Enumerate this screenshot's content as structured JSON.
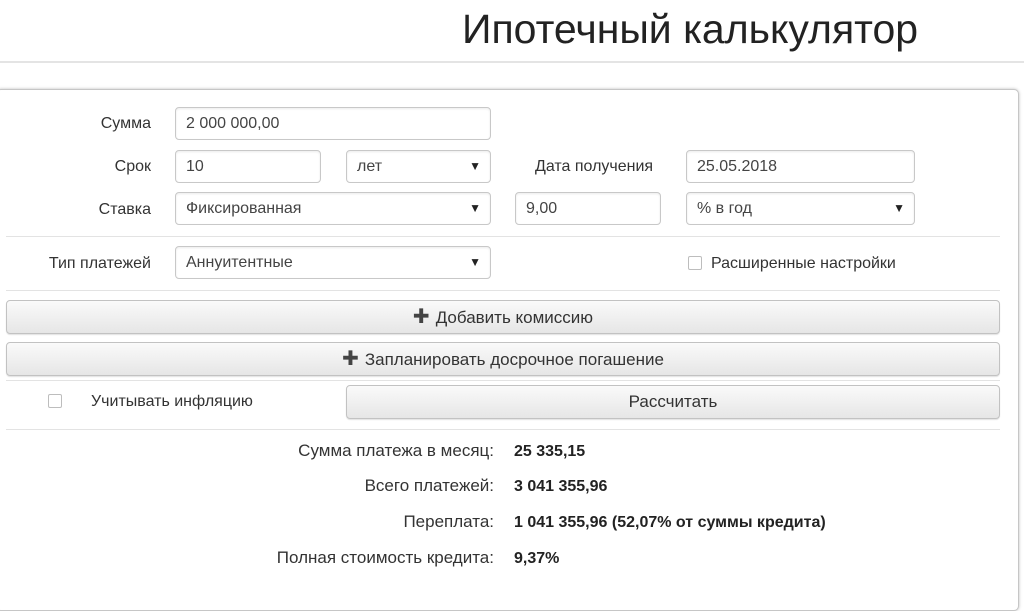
{
  "header": {
    "title": "Ипотечный калькулятор"
  },
  "form": {
    "sum_label": "Сумма",
    "sum_value": "2 000 000,00",
    "term_label": "Срок",
    "term_value": "10",
    "term_unit": "лет",
    "date_label": "Дата получения",
    "date_value": "25.05.2018",
    "rate_label": "Ставка",
    "rate_type": "Фиксированная",
    "rate_value": "9,00",
    "rate_unit": "% в год",
    "payment_type_label": "Тип платежей",
    "payment_type_value": "Аннуитентные",
    "advanced_settings_label": "Расширенные настройки",
    "select_arrow": "▼"
  },
  "actions": {
    "add_commission": "Добавить комиссию",
    "plan_early_repayment": "Запланировать досрочное погашение",
    "plus_icon": "✚",
    "inflation_label": "Учитывать инфляцию",
    "calculate": "Рассчитать"
  },
  "results": [
    {
      "label": "Сумма платежа в месяц:",
      "value": "25 335,15"
    },
    {
      "label": "Всего платежей:",
      "value": "3 041 355,96"
    },
    {
      "label": "Переплата:",
      "value": "1 041 355,96 (52,07% от суммы кредита)"
    },
    {
      "label": "Полная стоимость кредита:",
      "value": "9,37%"
    }
  ]
}
